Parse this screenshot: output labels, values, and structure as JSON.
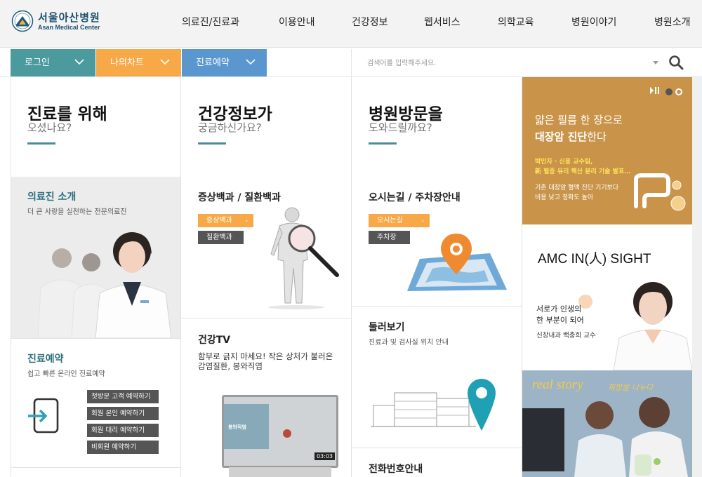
{
  "header": {
    "logo_ko": "서울아산병원",
    "logo_en": "Asan Medical Center",
    "nav": [
      "의료진/진료과",
      "이용안내",
      "건강정보",
      "웹서비스",
      "의학교육",
      "병원이야기",
      "병원소개"
    ]
  },
  "quickbar": {
    "login": "로그인",
    "mychart": "나의차트",
    "reservation": "진료예약",
    "search_placeholder": "검색어를 입력해주세요."
  },
  "col1": {
    "hero_title": "진료를 위해",
    "hero_sub": "오셨나요?",
    "doctors_title": "의료진 소개",
    "doctors_desc": "더 큰 사랑을 실천하는 전문의료진",
    "reserve_title": "진료예약",
    "reserve_desc": "쉽고 빠른 온라인 진료예약",
    "reserve_buttons": [
      "첫방문 고객 예약하기",
      "회원 본인 예약하기",
      "회원 대리 예약하기",
      "비회원 예약하기"
    ]
  },
  "col2": {
    "hero_title": "건강정보가",
    "hero_sub": "궁금하신가요?",
    "ency_title": "증상백과 / 질환백과",
    "tag_symptom": "증상백과",
    "tag_disease": "질환백과",
    "tv_title": "건강TV",
    "tv_desc_1": "함부로 긁지 마세요! 작은 상처가 불러온",
    "tv_desc_2": "감염질환, 봉와직염",
    "video_label": "봉와직염",
    "video_duration": "03:03"
  },
  "col3": {
    "hero_title": "병원방문을",
    "hero_sub": "도와드릴까요?",
    "map_title": "오시는길 / 주차장안내",
    "tag_directions": "오시는길",
    "tag_parking": "주차장",
    "tour_title": "둘러보기",
    "tour_desc": "진료과 및 검사실 위치 안내",
    "phone_title": "전화번호안내"
  },
  "banners": {
    "b1_line1": "얇은 필름 한 장으로",
    "b1_line2_bold": "대장암 진단",
    "b1_line2_rest": "한다",
    "b1_yellow_1": "박인자 · 신용 교수팀,",
    "b1_yellow_2": "新 혈중 유리 핵산 분리 기술 발표…",
    "b1_white_1": "기존 대장암 혈액 진단 기기보다",
    "b1_white_2": "비용 낮고 정확도 높아",
    "b2_title": "AMC IN(人) SIGHT",
    "b2_line1": "서로가 인생의",
    "b2_line2": "한 부분이 되어",
    "b2_line3": "신장내과 백충희 교수",
    "b3_title": "real story",
    "b3_sub": "희망을 나누다"
  },
  "colors": {
    "teal": "#4a9a9e",
    "orange": "#f7a948",
    "blue": "#5a97cf",
    "banner_gold": "#c9944a"
  }
}
